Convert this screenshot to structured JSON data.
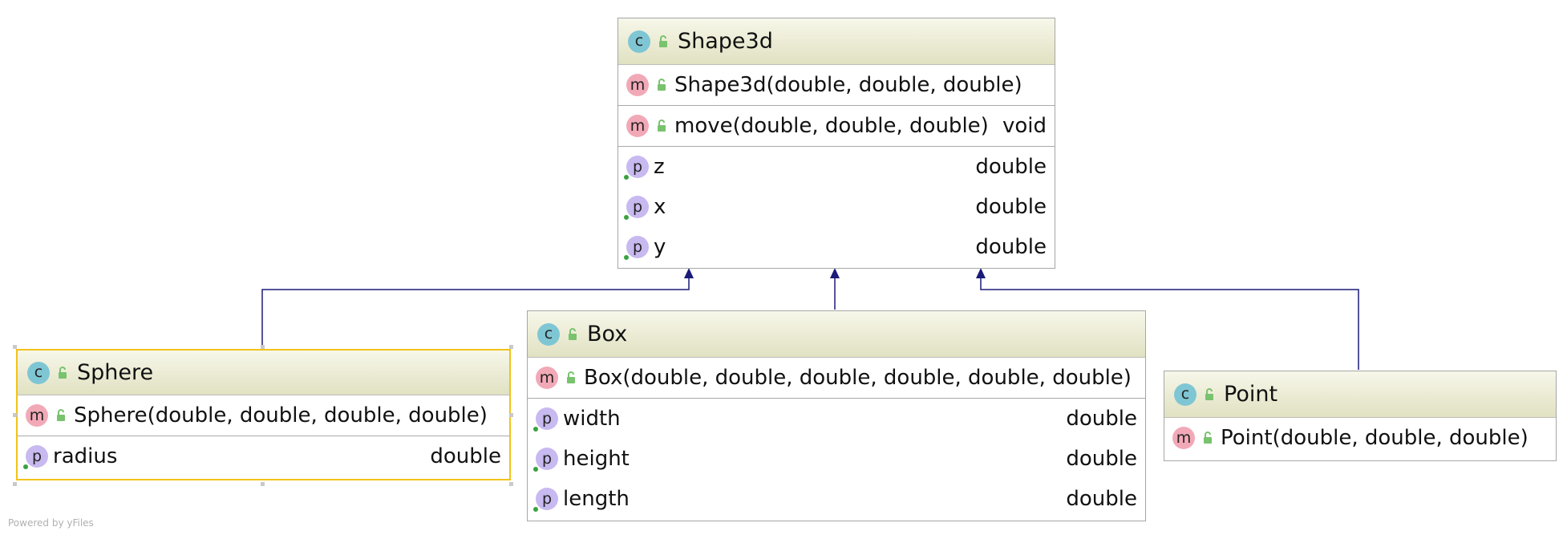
{
  "diagram": {
    "classes": {
      "shape3d": {
        "name": "Shape3d",
        "constructor": "Shape3d(double, double, double)",
        "method": {
          "signature": "move(double, double, double)",
          "returns": "void"
        },
        "fields": [
          {
            "name": "z",
            "type": "double"
          },
          {
            "name": "x",
            "type": "double"
          },
          {
            "name": "y",
            "type": "double"
          }
        ]
      },
      "sphere": {
        "name": "Sphere",
        "constructor": "Sphere(double, double, double, double)",
        "fields": [
          {
            "name": "radius",
            "type": "double"
          }
        ]
      },
      "box": {
        "name": "Box",
        "constructor": "Box(double, double, double, double, double, double)",
        "fields": [
          {
            "name": "width",
            "type": "double"
          },
          {
            "name": "height",
            "type": "double"
          },
          {
            "name": "length",
            "type": "double"
          }
        ]
      },
      "point": {
        "name": "Point",
        "constructor": "Point(double, double, double)"
      }
    },
    "inheritance": [
      {
        "from": "Sphere",
        "to": "Shape3d"
      },
      {
        "from": "Box",
        "to": "Shape3d"
      },
      {
        "from": "Point",
        "to": "Shape3d"
      }
    ],
    "icons": {
      "class": "c",
      "method": "m",
      "property": "p"
    },
    "colors": {
      "edge": "#1b1b7a",
      "class_icon": "#7fc6d4",
      "method_icon": "#f2a9b7",
      "property_icon": "#c8b9f0",
      "selection": "#f2c318"
    },
    "watermark": "Powered by yFiles"
  }
}
